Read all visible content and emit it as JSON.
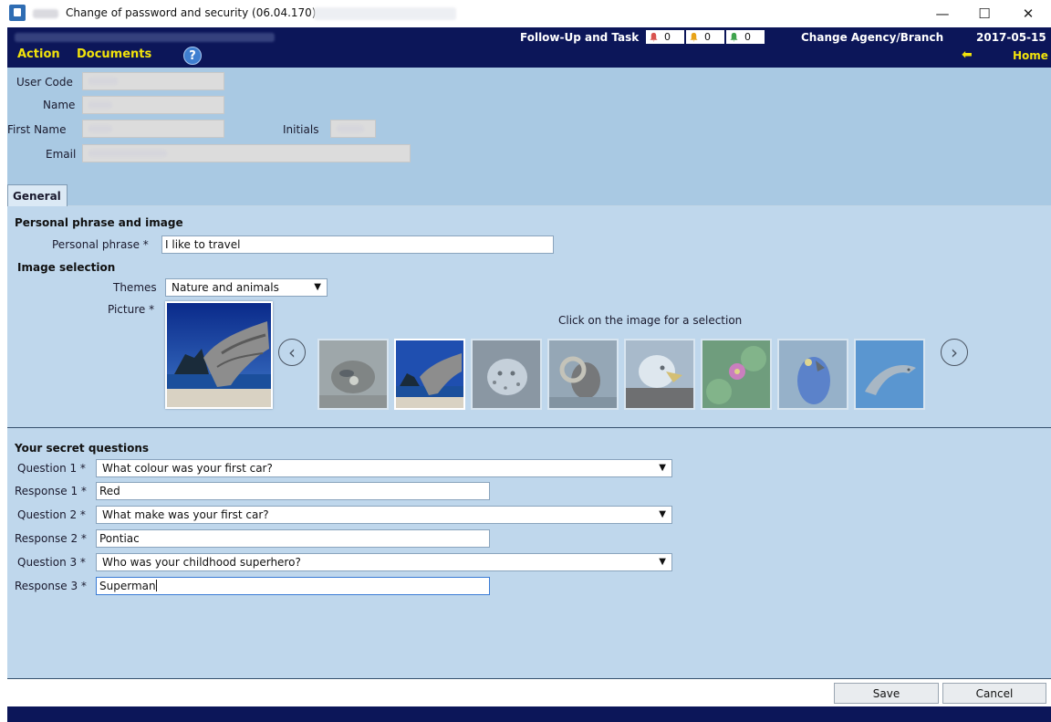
{
  "window": {
    "title": "Change of password and security (06.04.170)",
    "minimize_label": "—",
    "maximize_label": "☐",
    "close_label": "✕"
  },
  "header": {
    "menu": {
      "action": "Action",
      "documents": "Documents"
    },
    "help_label": "?",
    "follow_up_label": "Follow-Up and Task",
    "counters": [
      {
        "count": "0",
        "color": "#d9534f"
      },
      {
        "count": "0",
        "color": "#e8a317"
      },
      {
        "count": "0",
        "color": "#3fa34d"
      }
    ],
    "change_agency_label": "Change Agency/Branch",
    "date": "2017-05-15",
    "back_arrow": "⬅",
    "home_label": "Home"
  },
  "user_info": {
    "user_code_label": "User Code",
    "name_label": "Name",
    "first_name_label": "First Name",
    "initials_label": "Initials",
    "email_label": "Email"
  },
  "tabs": [
    {
      "label": "General"
    }
  ],
  "personal": {
    "section_title": "Personal phrase and image",
    "phrase_label": "Personal phrase *",
    "phrase_value": "I like to travel",
    "image_section_title": "Image selection",
    "themes_label": "Themes",
    "themes_value": "Nature and animals",
    "picture_label": "Picture *",
    "hint": "Click on the image for a selection",
    "prev_label": "‹",
    "next_label": "›",
    "thumbnails": [
      {
        "name": "raccoon",
        "selected": false
      },
      {
        "name": "driftwood-beach",
        "selected": true
      },
      {
        "name": "snow-leopard",
        "selected": false
      },
      {
        "name": "ram",
        "selected": false
      },
      {
        "name": "eagle",
        "selected": false
      },
      {
        "name": "lotus-flower",
        "selected": false
      },
      {
        "name": "parrot",
        "selected": false
      },
      {
        "name": "dolphin",
        "selected": false
      }
    ]
  },
  "secret": {
    "section_title": "Your secret questions",
    "items": [
      {
        "q_label": "Question 1 *",
        "question": "What colour was your first car?",
        "r_label": "Response 1 *",
        "response": "Red"
      },
      {
        "q_label": "Question 2 *",
        "question": "What make was your first car?",
        "r_label": "Response 2 *",
        "response": "Pontiac"
      },
      {
        "q_label": "Question 3 *",
        "question": "Who was your childhood superhero?",
        "r_label": "Response 3 *",
        "response": "Superman"
      }
    ]
  },
  "buttons": {
    "save": "Save",
    "cancel": "Cancel"
  }
}
